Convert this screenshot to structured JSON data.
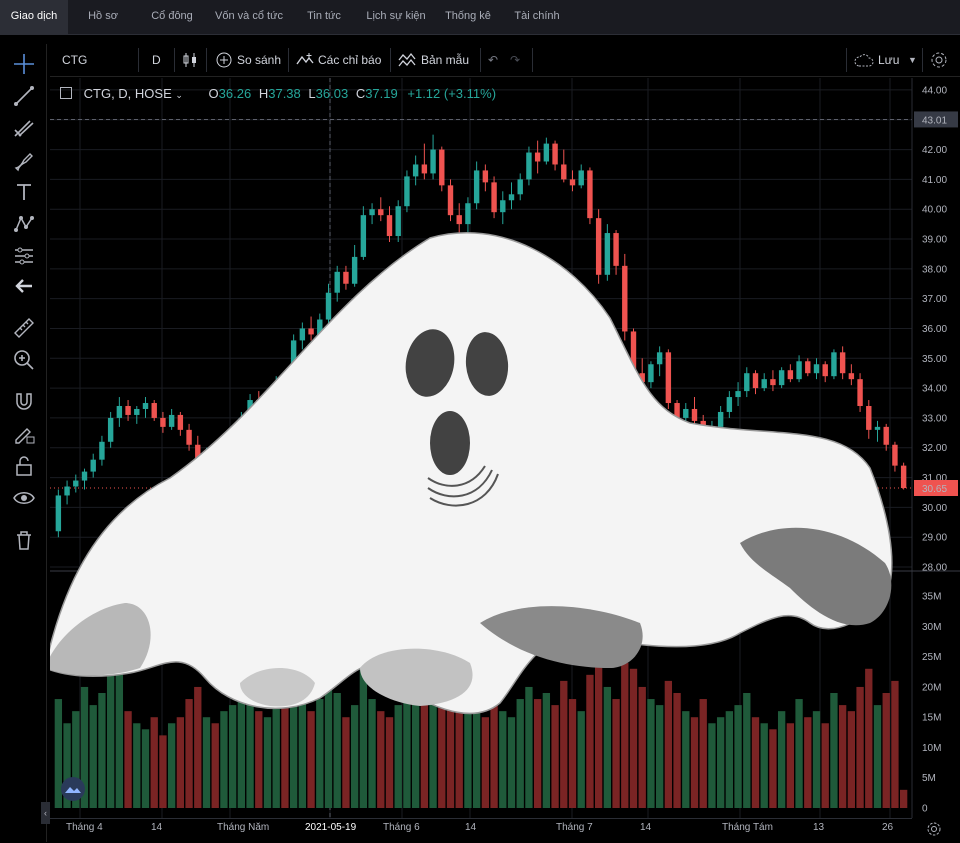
{
  "nav": {
    "tabs": [
      "Giao dịch",
      "Hồ sơ",
      "Cổ đông",
      "Vốn và cổ tức",
      "Tin tức",
      "Lịch sự kiện",
      "Thống kê",
      "Tài chính"
    ]
  },
  "toolbar": {
    "symbol": "CTG",
    "interval": "D",
    "compare": "So sánh",
    "indicators": "Các chỉ báo",
    "templates": "Bản mẫu",
    "save": "Lưu"
  },
  "legend": {
    "title": "CTG, D, HOSE",
    "o_label": "O",
    "o": "36.26",
    "h_label": "H",
    "h": "37.38",
    "l_label": "L",
    "l": "36.03",
    "c_label": "C",
    "c": "37.19",
    "change": "+1.12 (+3.11%)"
  },
  "colors": {
    "up": "#26a69a",
    "down": "#ef5350",
    "vol_up": "#1f5a3a",
    "vol_down": "#7a2424",
    "grid": "#1a1c22"
  },
  "chart_data": {
    "type": "candlestick",
    "price_axis": {
      "ticks": [
        "44.00",
        "43.00",
        "42.00",
        "41.00",
        "40.00",
        "39.00",
        "38.00",
        "37.00",
        "36.00",
        "35.00",
        "34.00",
        "33.00",
        "32.00",
        "31.00",
        "30.00",
        "29.00",
        "28.00"
      ],
      "ylim": [
        27.9,
        44.4
      ],
      "crosshair_price": "43.01",
      "last_price": "30.65"
    },
    "volume_axis": {
      "ticks": [
        "35M",
        "30M",
        "25M",
        "20M",
        "15M",
        "10M",
        "5M",
        "0"
      ],
      "ylim": [
        0,
        38
      ]
    },
    "x_labels": [
      "Tháng 4",
      "14",
      "Tháng Năm",
      "2021-05-19",
      "Tháng 6",
      "14",
      "Tháng 7",
      "14",
      "Tháng Tám",
      "13",
      "26"
    ],
    "candles": [
      [
        29.2,
        30.6,
        29.0,
        30.4,
        18
      ],
      [
        30.4,
        30.9,
        30.1,
        30.7,
        14
      ],
      [
        30.7,
        31.1,
        30.5,
        30.9,
        16
      ],
      [
        30.9,
        31.3,
        30.6,
        31.2,
        20
      ],
      [
        31.2,
        31.8,
        31.0,
        31.6,
        17
      ],
      [
        31.6,
        32.4,
        31.4,
        32.2,
        19
      ],
      [
        32.2,
        33.2,
        32.0,
        33.0,
        22
      ],
      [
        33.0,
        33.7,
        32.7,
        33.4,
        26
      ],
      [
        33.4,
        33.6,
        32.9,
        33.1,
        16
      ],
      [
        33.1,
        33.4,
        32.8,
        33.3,
        14
      ],
      [
        33.3,
        33.7,
        33.0,
        33.5,
        13
      ],
      [
        33.5,
        33.6,
        32.9,
        33.0,
        15
      ],
      [
        33.0,
        33.2,
        32.5,
        32.7,
        12
      ],
      [
        32.7,
        33.3,
        32.6,
        33.1,
        14
      ],
      [
        33.1,
        33.2,
        32.4,
        32.6,
        15
      ],
      [
        32.6,
        32.8,
        31.9,
        32.1,
        18
      ],
      [
        32.1,
        32.4,
        31.2,
        31.4,
        20
      ],
      [
        31.4,
        32.0,
        31.2,
        31.8,
        15
      ],
      [
        31.8,
        32.2,
        31.3,
        31.5,
        14
      ],
      [
        31.5,
        31.9,
        31.1,
        31.7,
        16
      ],
      [
        31.7,
        32.3,
        31.5,
        32.1,
        17
      ],
      [
        32.1,
        33.2,
        32.0,
        33.0,
        19
      ],
      [
        33.0,
        33.8,
        32.8,
        33.6,
        20
      ],
      [
        33.6,
        33.9,
        32.9,
        33.1,
        16
      ],
      [
        33.1,
        33.4,
        32.7,
        33.2,
        15
      ],
      [
        33.2,
        34.4,
        33.1,
        34.2,
        22
      ],
      [
        34.2,
        34.6,
        33.6,
        34.0,
        18
      ],
      [
        34.0,
        35.8,
        33.9,
        35.6,
        24
      ],
      [
        35.6,
        36.2,
        35.3,
        36.0,
        21
      ],
      [
        36.0,
        36.4,
        35.6,
        35.8,
        16
      ],
      [
        35.8,
        36.5,
        35.7,
        36.3,
        18
      ],
      [
        36.3,
        37.5,
        36.1,
        37.2,
        20
      ],
      [
        37.2,
        38.1,
        36.9,
        37.9,
        19
      ],
      [
        37.9,
        38.1,
        37.3,
        37.5,
        15
      ],
      [
        37.5,
        38.8,
        37.4,
        38.4,
        17
      ],
      [
        38.4,
        40.1,
        38.3,
        39.8,
        23
      ],
      [
        39.8,
        40.2,
        39.5,
        40.0,
        18
      ],
      [
        40.0,
        40.4,
        39.6,
        39.8,
        16
      ],
      [
        39.8,
        40.1,
        38.9,
        39.1,
        15
      ],
      [
        39.1,
        40.3,
        38.9,
        40.1,
        17
      ],
      [
        40.1,
        41.3,
        39.9,
        41.1,
        21
      ],
      [
        41.1,
        41.8,
        40.8,
        41.5,
        20
      ],
      [
        41.5,
        42.2,
        41.0,
        41.2,
        19
      ],
      [
        41.2,
        42.5,
        41.0,
        42.0,
        22
      ],
      [
        42.0,
        42.1,
        40.6,
        40.8,
        18
      ],
      [
        40.8,
        41.0,
        39.6,
        39.8,
        20
      ],
      [
        39.8,
        40.2,
        39.0,
        39.5,
        17
      ],
      [
        39.5,
        40.4,
        39.2,
        40.2,
        16
      ],
      [
        40.2,
        41.6,
        40.0,
        41.3,
        18
      ],
      [
        41.3,
        41.5,
        40.6,
        40.9,
        15
      ],
      [
        40.9,
        41.1,
        39.7,
        39.9,
        17
      ],
      [
        39.9,
        40.6,
        39.5,
        40.3,
        16
      ],
      [
        40.3,
        40.9,
        40.0,
        40.5,
        15
      ],
      [
        40.5,
        41.2,
        40.3,
        41.0,
        18
      ],
      [
        41.0,
        42.1,
        40.8,
        41.9,
        20
      ],
      [
        41.9,
        42.3,
        41.2,
        41.6,
        18
      ],
      [
        41.6,
        42.4,
        41.5,
        42.2,
        19
      ],
      [
        42.2,
        42.3,
        41.3,
        41.5,
        17
      ],
      [
        41.5,
        42.0,
        40.9,
        41.0,
        21
      ],
      [
        41.0,
        41.3,
        40.6,
        40.8,
        18
      ],
      [
        40.8,
        41.5,
        40.7,
        41.3,
        16
      ],
      [
        41.3,
        41.4,
        39.5,
        39.7,
        22
      ],
      [
        39.7,
        40.0,
        37.5,
        37.8,
        25
      ],
      [
        37.8,
        39.5,
        37.6,
        39.2,
        20
      ],
      [
        39.2,
        39.3,
        37.8,
        38.1,
        18
      ],
      [
        38.1,
        38.5,
        35.6,
        35.9,
        24
      ],
      [
        35.9,
        36.0,
        34.3,
        34.5,
        23
      ],
      [
        34.5,
        35.0,
        33.4,
        34.2,
        20
      ],
      [
        34.2,
        34.9,
        34.0,
        34.8,
        18
      ],
      [
        34.8,
        35.4,
        34.4,
        35.2,
        17
      ],
      [
        35.2,
        35.3,
        33.3,
        33.5,
        21
      ],
      [
        33.5,
        33.6,
        32.8,
        33.0,
        19
      ],
      [
        33.0,
        33.5,
        32.6,
        33.3,
        16
      ],
      [
        33.3,
        33.7,
        32.8,
        32.9,
        15
      ],
      [
        32.9,
        33.1,
        32.2,
        32.4,
        18
      ],
      [
        32.4,
        32.9,
        31.9,
        32.7,
        14
      ],
      [
        32.7,
        33.4,
        32.5,
        33.2,
        15
      ],
      [
        33.2,
        33.9,
        33.0,
        33.7,
        16
      ],
      [
        33.7,
        34.2,
        33.4,
        33.9,
        17
      ],
      [
        33.9,
        34.7,
        33.7,
        34.5,
        19
      ],
      [
        34.5,
        34.6,
        33.8,
        34.0,
        15
      ],
      [
        34.0,
        34.5,
        33.9,
        34.3,
        14
      ],
      [
        34.3,
        34.6,
        33.9,
        34.1,
        13
      ],
      [
        34.1,
        34.7,
        34.0,
        34.6,
        16
      ],
      [
        34.6,
        34.8,
        34.2,
        34.3,
        14
      ],
      [
        34.3,
        35.1,
        34.2,
        34.9,
        18
      ],
      [
        34.9,
        35.0,
        34.4,
        34.5,
        15
      ],
      [
        34.5,
        35.0,
        34.3,
        34.8,
        16
      ],
      [
        34.8,
        34.9,
        34.2,
        34.4,
        14
      ],
      [
        34.4,
        35.3,
        34.3,
        35.2,
        19
      ],
      [
        35.2,
        35.4,
        34.3,
        34.5,
        17
      ],
      [
        34.5,
        34.8,
        34.1,
        34.3,
        16
      ],
      [
        34.3,
        34.5,
        33.2,
        33.4,
        20
      ],
      [
        33.4,
        33.6,
        32.3,
        32.6,
        23
      ],
      [
        32.6,
        32.9,
        32.2,
        32.7,
        17
      ],
      [
        32.7,
        32.8,
        31.9,
        32.1,
        19
      ],
      [
        32.1,
        32.2,
        31.2,
        31.4,
        21
      ],
      [
        31.4,
        31.5,
        30.6,
        30.65,
        3
      ]
    ]
  }
}
